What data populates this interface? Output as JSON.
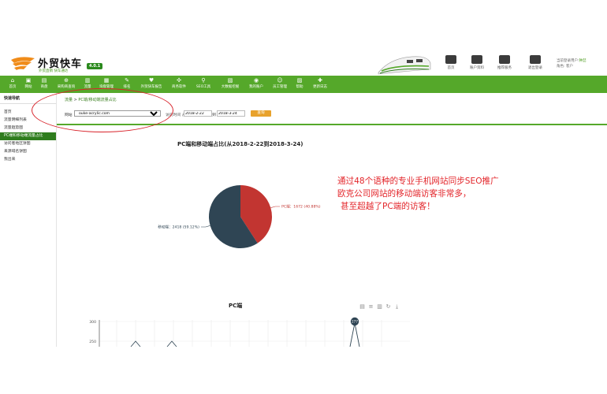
{
  "header": {
    "brand_title": "外贸快车",
    "brand_slogan": "外贸直销  快车通达",
    "version": "4.0.1",
    "toplinks": [
      {
        "label": "首页",
        "icon": "home-icon"
      },
      {
        "label": "账户资料",
        "icon": "briefcase-icon"
      },
      {
        "label": "推荐服务",
        "icon": "box-icon"
      },
      {
        "label": "退出登录",
        "icon": "power-icon"
      }
    ],
    "user": {
      "line1_prefix": "当前登录用户:",
      "line1_name": "钟喆",
      "line2": "角色: 客户"
    }
  },
  "nav": {
    "items": [
      {
        "label": "首页",
        "icon": "⌂"
      },
      {
        "label": "网站",
        "icon": "▣"
      },
      {
        "label": "商盘",
        "icon": "▤"
      },
      {
        "label": "采购商查询",
        "icon": "⊕"
      },
      {
        "label": "流量",
        "icon": "▥"
      },
      {
        "label": "询盘管理",
        "icon": "▦"
      },
      {
        "label": "排名",
        "icon": "✎"
      },
      {
        "label": "外贸快车报告",
        "icon": "♥"
      },
      {
        "label": "商务软件",
        "icon": "✣"
      },
      {
        "label": "SEO工具",
        "icon": "⚲"
      },
      {
        "label": "大数据挖掘",
        "icon": "▧"
      },
      {
        "label": "我的账户",
        "icon": "◉"
      },
      {
        "label": "员工管理",
        "icon": "☺"
      },
      {
        "label": "帮助",
        "icon": "▨"
      },
      {
        "label": "更新日志",
        "icon": "✚"
      }
    ]
  },
  "sidebar": {
    "title": "快速导航",
    "items": [
      {
        "label": "首页",
        "active": false
      },
      {
        "label": "流量明细列表",
        "active": false
      },
      {
        "label": "流量趋势图",
        "active": false
      },
      {
        "label": "PC端和移动端流量占比",
        "active": true
      },
      {
        "label": "访问者地区饼图",
        "active": false
      },
      {
        "label": "来源域名饼图",
        "active": false
      },
      {
        "label": "我出来",
        "active": false
      }
    ]
  },
  "main": {
    "breadcrumb_root": "流量",
    "breadcrumb_sep": " > ",
    "breadcrumb_current": "PC端/移动端流量占比",
    "filter": {
      "site_label": "网站",
      "site_value": "ouke-acrylic.com",
      "date_label": "访问时间 从",
      "date_from": "2018-2-22",
      "to_label": "到",
      "date_to": "2018-3-24",
      "query_button": "查询"
    }
  },
  "pie": {
    "title": "PC端和移动端占比(从2018-2-22到2018-3-24)",
    "pc_label": "PC端：1672 (40.88%)",
    "mobile_label": "移动端：2418 (59.12%)"
  },
  "annotation": {
    "line1": "通过48个语种的专业手机网站同步SEO推广",
    "line2": "欧克公司网站的移动端访客非常多，",
    "line3": "甚至超越了PC端的访客！"
  },
  "line_chart": {
    "title": "PC端",
    "tools": [
      "▤",
      "≡",
      "▥",
      "↻",
      "⤓"
    ],
    "ytick_300": "300",
    "ytick_250": "250",
    "peak_label": "277"
  },
  "chart_data": [
    {
      "type": "pie",
      "title": "PC端和移动端占比(从2018-2-22到2018-3-24)",
      "categories": [
        "PC端",
        "移动端"
      ],
      "values": [
        1672,
        2418
      ],
      "percent": [
        40.88,
        59.12
      ],
      "colors": [
        "#c23531",
        "#2f4554"
      ]
    },
    {
      "type": "line",
      "title": "PC端",
      "ylim": [
        0,
        300
      ],
      "yticks": [
        250,
        300
      ],
      "peak_value": 277,
      "colors": [
        "#2f4554"
      ]
    }
  ],
  "colors": {
    "nav_green": "#55a82a",
    "annotation_red": "#e3262b",
    "pc_red": "#c23531",
    "mobile_dark": "#2f4554"
  }
}
